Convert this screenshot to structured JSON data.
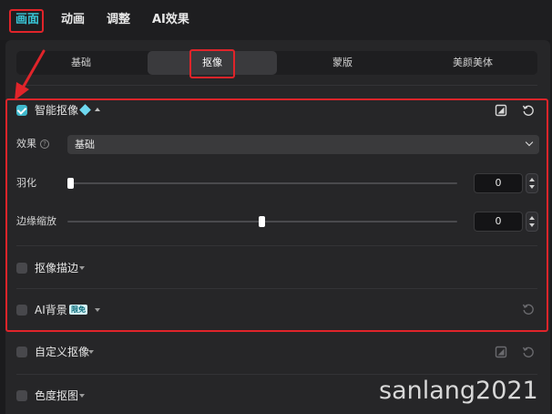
{
  "top_tabs": [
    {
      "label": "画面",
      "active": true
    },
    {
      "label": "动画",
      "active": false
    },
    {
      "label": "调整",
      "active": false
    },
    {
      "label": "AI效果",
      "active": false
    }
  ],
  "sub_tabs": [
    {
      "label": "基础",
      "active": false
    },
    {
      "label": "抠像",
      "active": true
    },
    {
      "label": "蒙版",
      "active": false
    },
    {
      "label": "美颜美体",
      "active": false
    }
  ],
  "smart_matting": {
    "label": "智能抠像",
    "checked": true,
    "effect_label": "效果",
    "effect_value": "基础",
    "feather_label": "羽化",
    "feather_value": "0",
    "feather_level": 0,
    "edge_scale_label": "边缘缩放",
    "edge_scale_value": "0",
    "edge_scale_level": 0.5
  },
  "matting_stroke": {
    "label": "抠像描边",
    "checked": false
  },
  "ai_background": {
    "label": "AI背景",
    "badge": "限免",
    "checked": false
  },
  "custom_matting": {
    "label": "自定义抠像",
    "checked": false
  },
  "chroma_key": {
    "label": "色度抠图",
    "checked": false
  },
  "watermark": "sanlang2021",
  "colors": {
    "accent": "#39c5d6",
    "highlight_red": "#e0242a",
    "panel_bg": "#262628"
  },
  "icons": [
    "diamond-icon",
    "caret-up-icon",
    "caret-down-icon",
    "compare-icon",
    "reset-icon",
    "help-icon",
    "chevron-down-icon",
    "arrow-annotation"
  ]
}
